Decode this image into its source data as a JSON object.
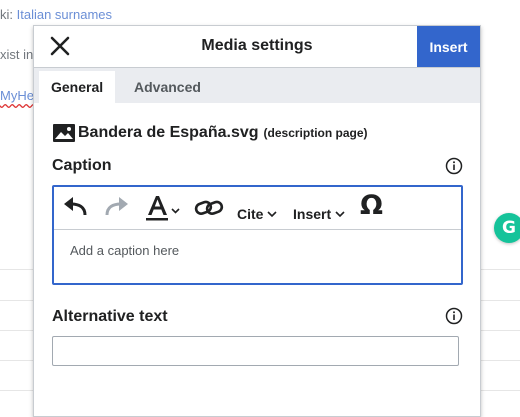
{
  "background": {
    "line1_prefix": "ki: ",
    "line1_link": "Italian surnames",
    "line2": "xist in",
    "line3_link": "MyHe"
  },
  "grammarly": {
    "letter": "G",
    "color": "#15c39a"
  },
  "dialog": {
    "title": "Media settings",
    "insert_label": "Insert",
    "tabs": [
      {
        "label": "General",
        "active": true
      },
      {
        "label": "Advanced",
        "active": false
      }
    ],
    "file": {
      "name": "Bandera de España.svg",
      "description_link": "(description page)"
    },
    "caption": {
      "label": "Caption",
      "toolbar": {
        "cite_label": "Cite",
        "insert_label": "Insert",
        "special_char": "Ω"
      },
      "placeholder": "Add a caption here"
    },
    "alt_text": {
      "label": "Alternative text",
      "value": ""
    }
  },
  "colors": {
    "accent": "#3366cc",
    "border": "#c8ccd1",
    "tab_bar": "#eaecf0"
  }
}
